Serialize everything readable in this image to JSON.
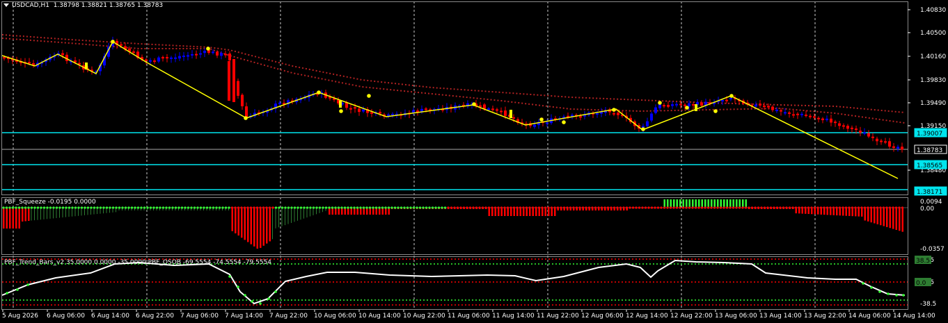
{
  "main": {
    "symbol_label": "USDCAD,H1",
    "ohlc": "1.38798 1.38821 1.38765 1.38783",
    "y_labels": [
      "1.40830",
      "1.40500",
      "1.40160",
      "1.39830",
      "1.39490",
      "1.39150",
      "1.38480"
    ],
    "boxed_labels": [
      {
        "text": "1.39007",
        "kind": "cyan"
      },
      {
        "text": "1.38783",
        "kind": "white"
      },
      {
        "text": "1.38565",
        "kind": "cyan"
      },
      {
        "text": "1.38171",
        "kind": "cyan"
      }
    ],
    "colors": {
      "bull": "#0000ff",
      "bear": "#ff0000",
      "zigzag": "#ffff00",
      "support": "#00e5ee",
      "ma": "#b22222",
      "grid": "#ffffff"
    }
  },
  "squeeze": {
    "label": "PBF_Squeeze -0.0195 0.0000",
    "y_labels": [
      "0.0094",
      "0.00",
      "-0.0357"
    ]
  },
  "trend": {
    "label": "PBF_Trend_Bars_v2 35.0000 0.0000 -35.0000  PBF_OSOB -69.5554 -74.5554 -79.5554",
    "y_labels": [
      "38.5",
      "38.5",
      "-38.5"
    ],
    "boxed_labels": [
      {
        "text": "38.5"
      },
      {
        "text": "0.0"
      }
    ]
  },
  "time_axis": [
    "5 Aug 2026",
    "6 Aug 06:00",
    "6 Aug 14:00",
    "6 Aug 22:00",
    "7 Aug 06:00",
    "7 Aug 14:00",
    "7 Aug 22:00",
    "10 Aug 06:00",
    "10 Aug 14:00",
    "10 Aug 22:00",
    "11 Aug 06:00",
    "11 Aug 14:00",
    "11 Aug 22:00",
    "12 Aug 06:00",
    "12 Aug 14:00",
    "12 Aug 22:00",
    "13 Aug 06:00",
    "13 Aug 14:00",
    "13 Aug 22:00",
    "14 Aug 06:00",
    "14 Aug 14:00"
  ]
}
